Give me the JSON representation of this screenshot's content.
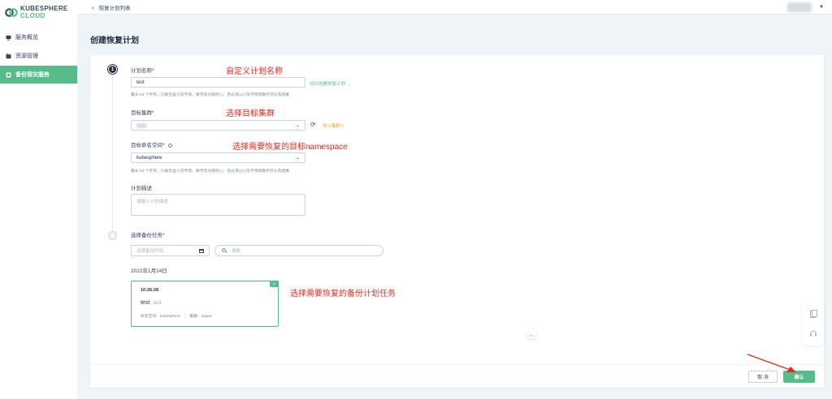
{
  "app": {
    "logo_line1": "KUBESPHERE",
    "logo_line2": "CLOUD",
    "brand_color": "#55bc8a"
  },
  "sidebar": {
    "items": [
      {
        "label": "服务概览",
        "icon": "monitor-icon",
        "active": false
      },
      {
        "label": "资源管理",
        "icon": "folder-icon",
        "active": false
      },
      {
        "label": "备份容灾服务",
        "icon": "backup-icon",
        "active": true
      }
    ]
  },
  "topbar": {
    "back_label": "恢复计划列表"
  },
  "page": {
    "title": "创建恢复计划"
  },
  "form": {
    "step1": "1",
    "step2": "2",
    "plan_name": {
      "label": "计划名称*",
      "value": "test",
      "hint": "最长 63 个字符，只能包含小写字母、数字及分隔符(-)，且必须以小写字母或数字开头及结尾",
      "help_link": "如何创建恢复计划 →"
    },
    "target_cluster": {
      "label": "目标集群*",
      "import_link": "导入集群入"
    },
    "target_namespace": {
      "label": "目标命名空间*",
      "value": "kubesphere",
      "hint": "最长 63 个字符，只能包含小写字母、数字及分隔符(-)，且必须以小写字母或数字开头及结尾"
    },
    "description": {
      "label": "计划描述",
      "placeholder": "请输入计划描述"
    },
    "backup_task": {
      "label": "选择备份任务*",
      "date_placeholder": "选择备份时间",
      "search_placeholder": "搜索",
      "date_group": "2022年1月24日",
      "task": {
        "time": "10:26:28",
        "name": "test",
        "size": "3e11",
        "namespace_label": "命名空间：",
        "namespace": "kubesphere",
        "cluster_label": "集群：",
        "cluster": "isqaur",
        "selected": true
      }
    }
  },
  "annotations": {
    "a1": "自定义计划名称",
    "a2": "选择目标集群",
    "a3": "选择需要恢复的目标namespace",
    "a4": "选择需要恢复的备份计划任务",
    "color": "#e02b20"
  },
  "footer": {
    "cancel_label": "取 消",
    "ok_label": "确认"
  }
}
